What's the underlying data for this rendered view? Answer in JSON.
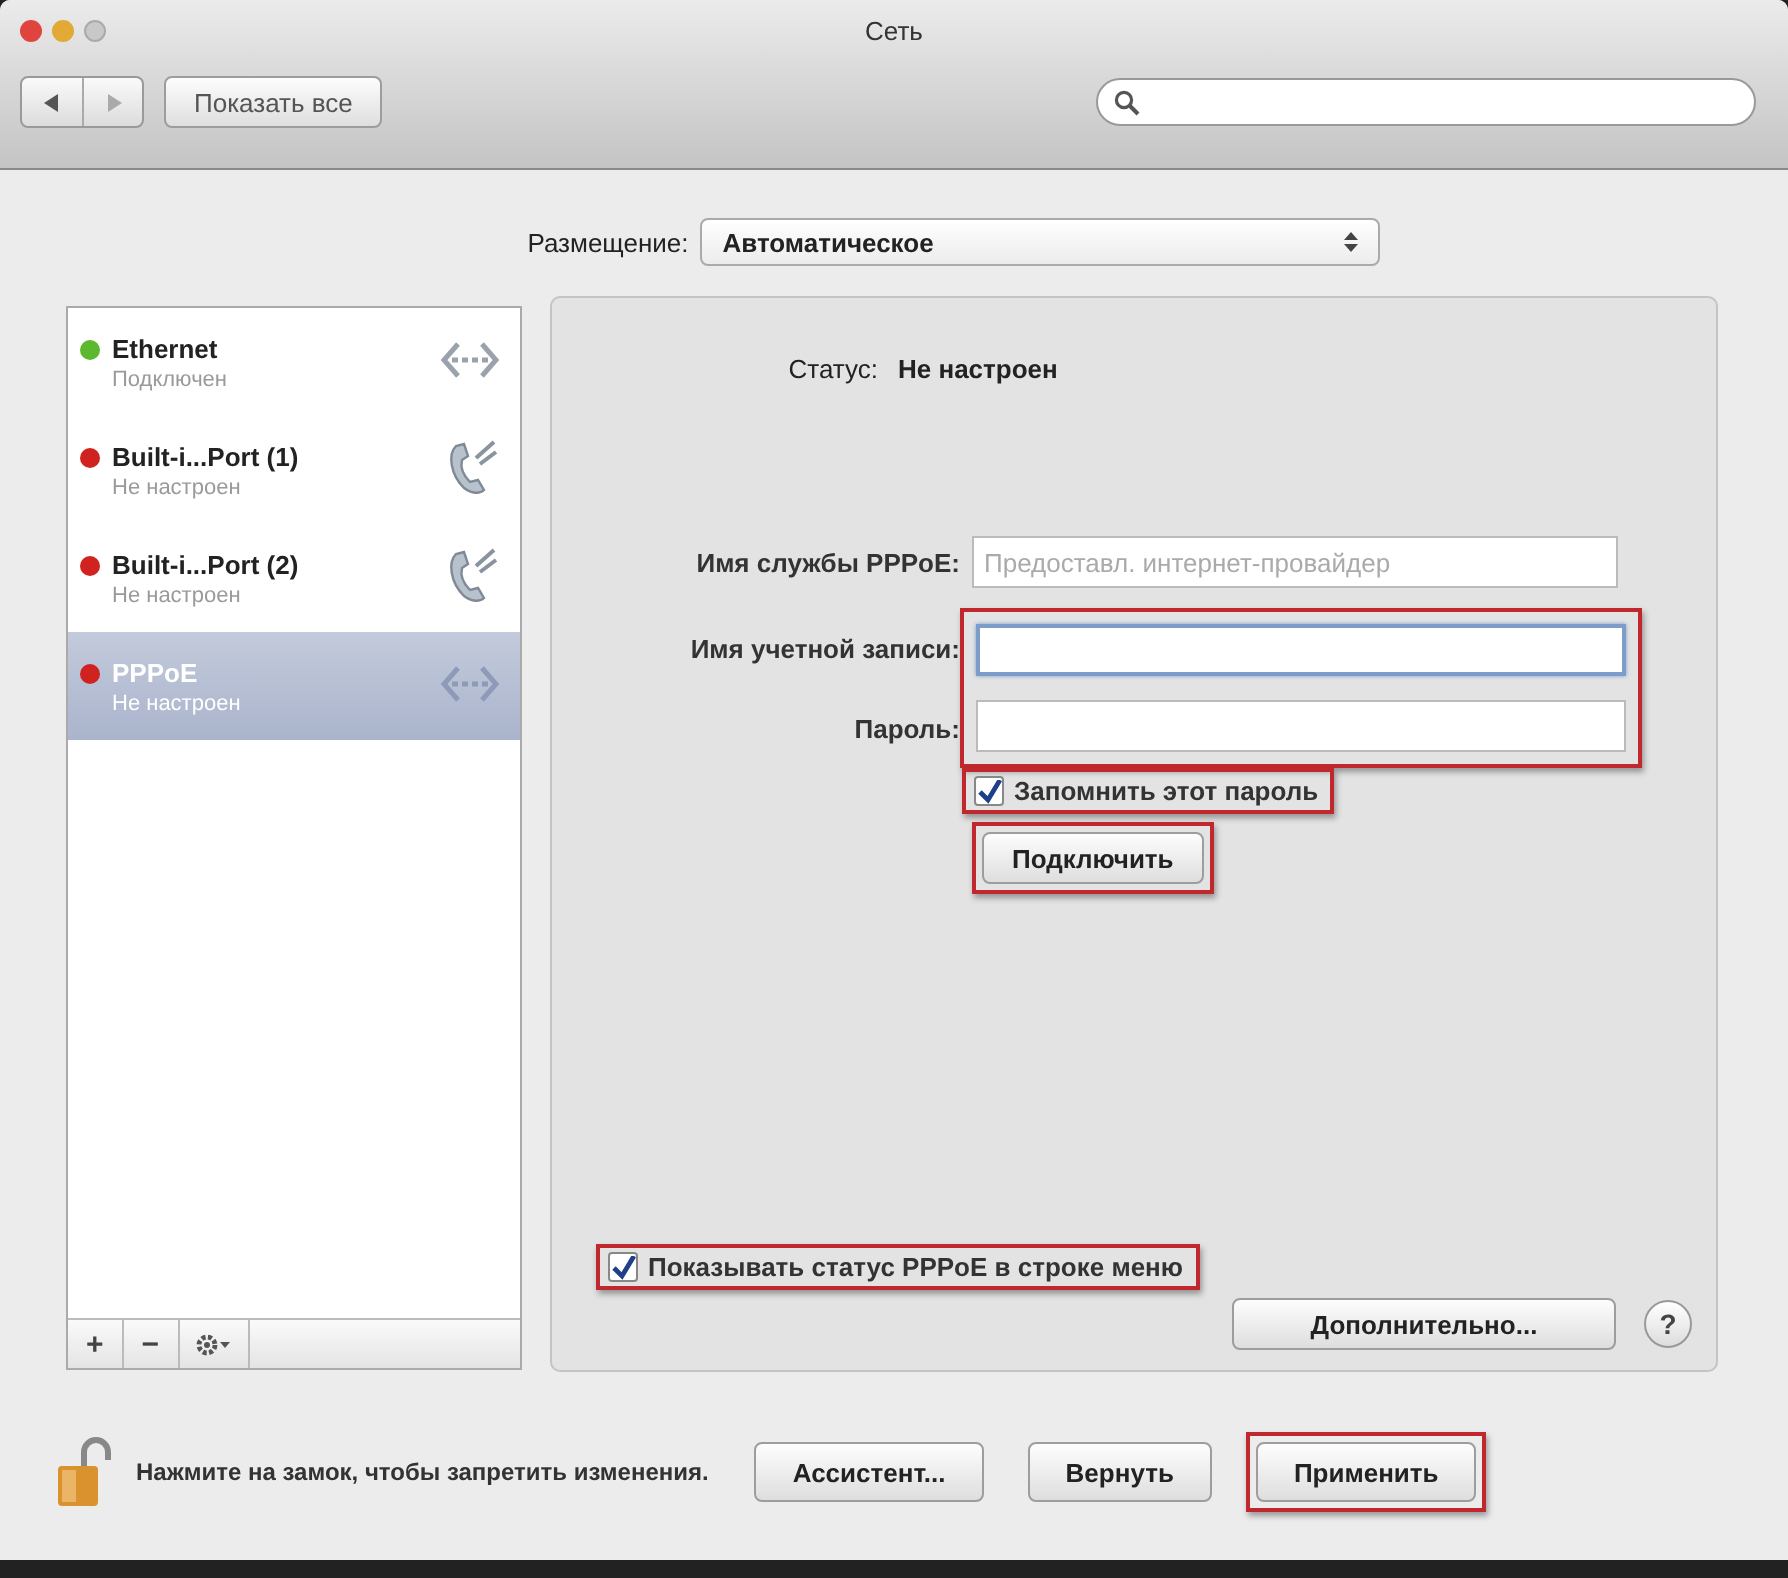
{
  "window": {
    "title": "Сеть"
  },
  "toolbar": {
    "show_all": "Показать все"
  },
  "location": {
    "label": "Размещение:",
    "value": "Автоматическое"
  },
  "services": [
    {
      "name": "Ethernet",
      "status": "Подключен",
      "color": "#5cb82e",
      "kind": "ethernet",
      "selected": false
    },
    {
      "name": "Built-i...Port (1)",
      "status": "Не настроен",
      "color": "#d0231f",
      "kind": "phone",
      "selected": false
    },
    {
      "name": "Built-i...Port (2)",
      "status": "Не настроен",
      "color": "#d0231f",
      "kind": "phone",
      "selected": false
    },
    {
      "name": "PPPoE",
      "status": "Не настроен",
      "color": "#d0231f",
      "kind": "ethernet",
      "selected": true
    }
  ],
  "service_buttons": {
    "add": "+",
    "remove": "−"
  },
  "detail": {
    "status_label": "Статус:",
    "status_value": "Не настроен",
    "service_field": {
      "label": "Имя службы PPPoE:",
      "placeholder": "Предоставл. интернет-провайдер"
    },
    "credentials_highlighted": true,
    "credential_fields": [
      {
        "label": "Имя учетной записи:",
        "focused": true
      },
      {
        "label": "Пароль:",
        "focused": false
      }
    ],
    "remember": {
      "label": "Запомнить этот пароль",
      "checked": true,
      "highlighted": true
    },
    "connect": {
      "label": "Подключить",
      "highlighted": true
    },
    "show_status": {
      "label": "Показывать статус PPPoE в строке меню",
      "checked": true,
      "highlighted": true
    },
    "advanced": "Дополнительно...",
    "help": "?"
  },
  "footer": {
    "lock_text": "Нажмите на замок, чтобы запретить изменения.",
    "buttons": [
      {
        "label": "Ассистент...",
        "highlighted": false
      },
      {
        "label": "Вернуть",
        "highlighted": false
      },
      {
        "label": "Применить",
        "highlighted": true
      }
    ]
  }
}
